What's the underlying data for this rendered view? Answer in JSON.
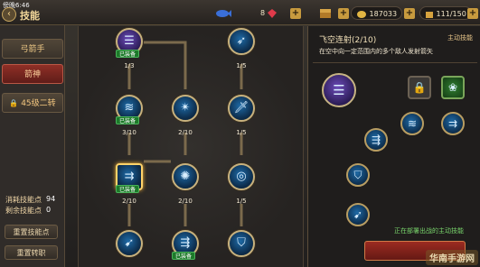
{
  "status": {
    "time": "傍晚6:46"
  },
  "header": {
    "title": "技能",
    "diamond_count": "8",
    "gold_count": "187033",
    "energy": "111/150"
  },
  "sidebar": {
    "tabs": [
      {
        "label": "弓箭手"
      },
      {
        "label": "箭神"
      },
      {
        "label": "45级二转"
      }
    ],
    "stats": {
      "consumed_label": "消耗技能点",
      "consumed_value": "94",
      "remaining_label": "剩余技能点",
      "remaining_value": "0"
    },
    "reset_points_label": "重置技能点",
    "reset_class_label": "重置转职"
  },
  "tree": {
    "equipped_label": "已装备",
    "levels": [
      "1/3",
      "1/5",
      "3/10",
      "2/10",
      "1/5",
      "2/10",
      "2/10",
      "1/5"
    ]
  },
  "panel": {
    "skill_title": "飞空连射(2/10)",
    "skill_type": "主动技能",
    "skill_desc": "在空中向一定范围内的多个敌人发射箭矢",
    "note": "正在部署出战的主动技能"
  },
  "watermark": "华南手游网",
  "colors": {
    "accent": "#c8a760",
    "active_tab": "#8f2f26",
    "equipped": "#1d7a2a"
  }
}
